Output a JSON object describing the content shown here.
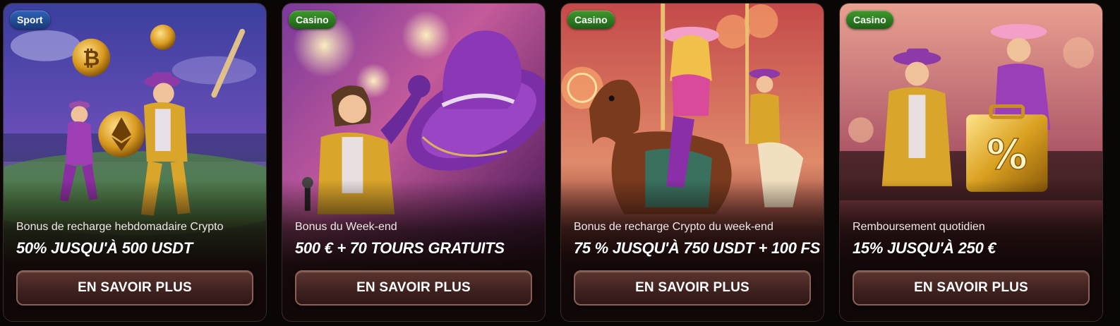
{
  "promotions": [
    {
      "category": "Sport",
      "subtitle": "Bonus de recharge hebdomadaire Crypto",
      "headline": "50% JUSQU'À 500 USDT",
      "cta": "EN SAVOIR PLUS"
    },
    {
      "category": "Casino",
      "subtitle": "Bonus du Week-end",
      "headline": "500 € + 70 TOURS GRATUITS",
      "cta": "EN SAVOIR PLUS"
    },
    {
      "category": "Casino",
      "subtitle": "Bonus de recharge Crypto du week-end",
      "headline": "75 % JUSQU'À 750 USDT + 100 FS",
      "cta": "EN SAVOIR PLUS"
    },
    {
      "category": "Casino",
      "subtitle": "Remboursement quotidien",
      "headline": "15% JUSQU'À 250 €",
      "cta": "EN SAVOIR PLUS"
    }
  ],
  "colors": {
    "sport_badge": "#2f63b8",
    "casino_badge": "#3e9a2c",
    "button_bg": "#4a2a26",
    "page_bg": "#0b0606"
  },
  "art": [
    "bitcoin-coin-icon",
    "ethereum-coin-icon",
    "purple-cowboy-hat",
    "carousel-horse",
    "percent-briefcase-icon"
  ]
}
